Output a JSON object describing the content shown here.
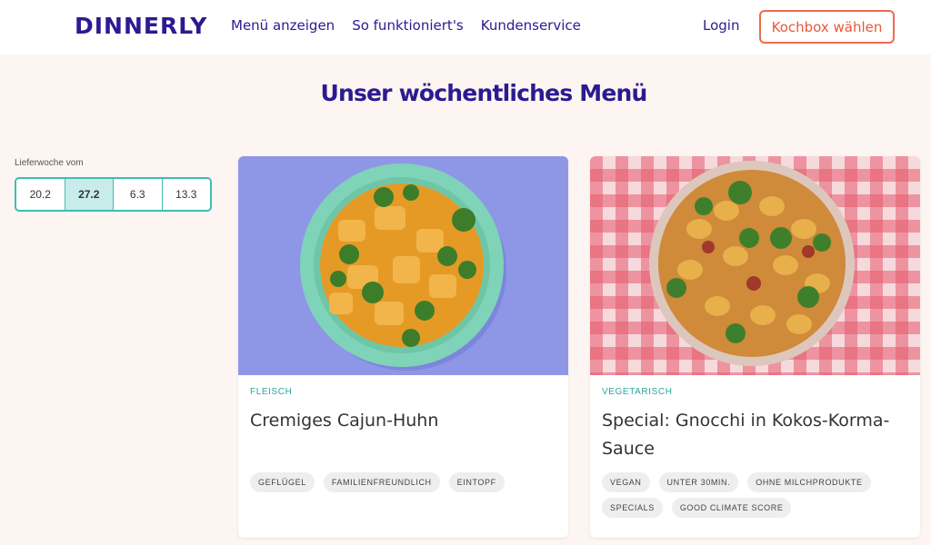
{
  "header": {
    "logo": "DINNERLY",
    "nav": [
      "Menü anzeigen",
      "So funktioniert's",
      "Kundenservice"
    ],
    "login": "Login",
    "cta": "Kochbox wählen"
  },
  "page": {
    "title": "Unser wöchentliches Menü"
  },
  "weeks": {
    "label": "Lieferwoche vom",
    "options": [
      "20.2",
      "27.2",
      "6.3",
      "13.3"
    ],
    "selected": "27.2"
  },
  "recipes": [
    {
      "category": "FLEISCH",
      "title": "Cremiges Cajun-Huhn",
      "tags": [
        "GEFLÜGEL",
        "FAMILIENFREUNDLICH",
        "EINTOPF"
      ]
    },
    {
      "category": "VEGETARISCH",
      "title": "Special: Gnocchi in Kokos-Korma-Sauce",
      "tags": [
        "VEGAN",
        "UNTER 30MIN.",
        "OHNE MILCHPRODUKTE",
        "SPECIALS",
        "GOOD CLIMATE SCORE"
      ]
    }
  ],
  "colors": {
    "brand": "#2b1a91",
    "accent": "#ef6a4c",
    "teal": "#3fbcb4",
    "background": "#fdf5f1"
  }
}
